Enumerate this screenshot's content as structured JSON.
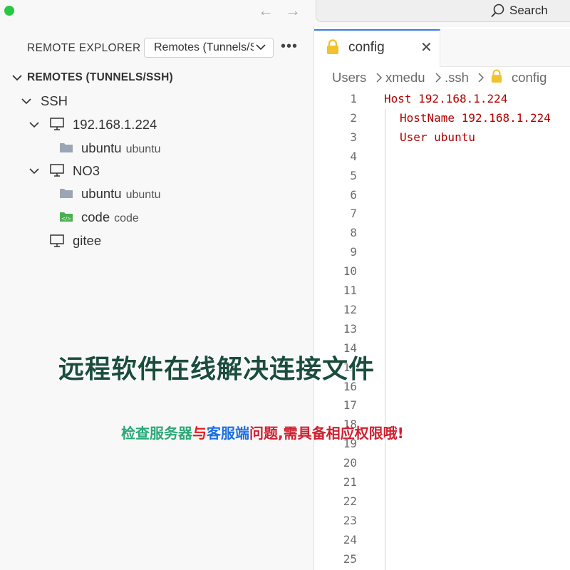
{
  "titlebar": {
    "search_label": "Search"
  },
  "sidebar": {
    "title": "REMOTE EXPLORER",
    "remote_select": "Remotes (Tunnels/SSH)",
    "section": "REMOTES (TUNNELS/SSH)",
    "tree": {
      "ssh_label": "SSH",
      "host1": {
        "label": "192.168.1.224",
        "folder": {
          "label": "ubuntu",
          "desc": "ubuntu"
        }
      },
      "host2": {
        "label": "NO3",
        "folders": [
          {
            "label": "ubuntu",
            "desc": "ubuntu"
          },
          {
            "label": "code",
            "desc": "code"
          }
        ]
      },
      "host3": {
        "label": "gitee"
      }
    }
  },
  "editor": {
    "tab_label": "config",
    "breadcrumb": [
      "Users",
      "xmedu",
      ".ssh",
      "config"
    ],
    "line_numbers": [
      "1",
      "2",
      "3",
      "4",
      "5",
      "6",
      "7",
      "8",
      "9",
      "10",
      "11",
      "12",
      "13",
      "14",
      "15",
      "16",
      "17",
      "18",
      "19",
      "20",
      "21",
      "22",
      "23",
      "24",
      "25"
    ],
    "code": {
      "line1": "Host 192.168.1.224",
      "line2": "HostName 192.168.1.224",
      "line3": "User ubuntu"
    }
  },
  "overlay": {
    "title": "远程软件在线解决连接文件",
    "subtitle": {
      "part1": "检查服务器",
      "part2": "与",
      "part3": "客服端",
      "part4": "问题,需具备相应权限哦!"
    }
  },
  "colors": {
    "accent": "#3c7ce4",
    "code": "#b00000",
    "lock": "#f2c12e",
    "folder": "#9aa6b3",
    "code_folder": "#4caf50",
    "overlay_title": "#1b4d3e"
  }
}
